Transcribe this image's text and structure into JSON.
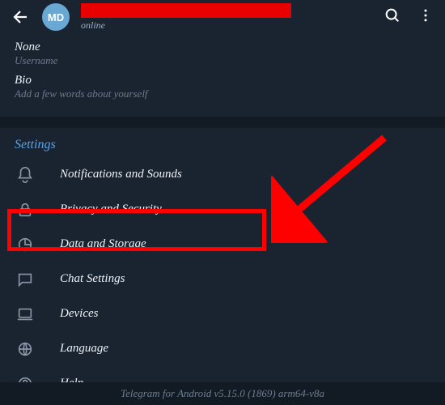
{
  "header": {
    "avatar_initials": "MD",
    "status": "online"
  },
  "profile": {
    "none_label": "None",
    "username_hint": "Username",
    "bio_label": "Bio",
    "bio_hint": "Add a few words about yourself"
  },
  "settings": {
    "header": "Settings",
    "items": [
      {
        "label": "Notifications and Sounds"
      },
      {
        "label": "Privacy and Security"
      },
      {
        "label": "Data and Storage"
      },
      {
        "label": "Chat Settings"
      },
      {
        "label": "Devices"
      },
      {
        "label": "Language"
      },
      {
        "label": "Help"
      }
    ]
  },
  "footer": "Telegram for Android v5.15.0 (1869) arm64-v8a"
}
